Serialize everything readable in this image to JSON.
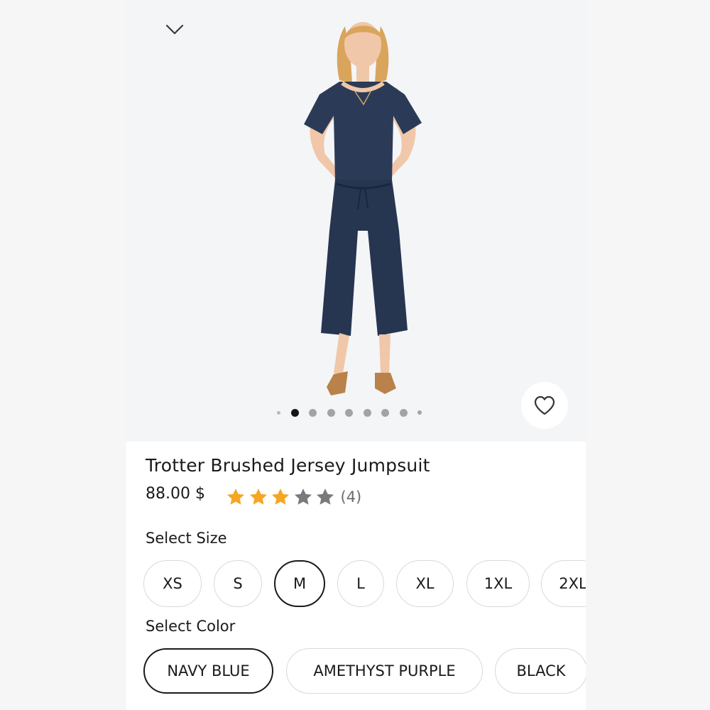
{
  "product": {
    "title": "Trotter Brushed Jersey Jumpsuit",
    "price": "88.00 $",
    "rating": {
      "stars": 3,
      "out_of": 5,
      "review_count": "(4)"
    },
    "image_alt": "Model wearing navy jumpsuit",
    "gallery": {
      "current_index": 1,
      "dot_count": 9
    }
  },
  "size": {
    "label": "Select Size",
    "options": [
      "XS",
      "S",
      "M",
      "L",
      "XL",
      "1XL",
      "2XL"
    ],
    "selected": "M"
  },
  "color": {
    "label": "Select Color",
    "options": [
      "NAVY BLUE",
      "AMETHYST PURPLE",
      "BLACK"
    ],
    "selected": "NAVY BLUE"
  },
  "icons": {
    "collapse": "chevron-down-icon",
    "favorite": "heart-outline-icon",
    "star": "star-icon"
  },
  "colors": {
    "star_filled": "#f5a623",
    "star_empty": "#7a7a7a",
    "selected_border": "#1a1a1a",
    "pill_border": "#d9d9d9",
    "garment_navy": "#2b3b57"
  }
}
